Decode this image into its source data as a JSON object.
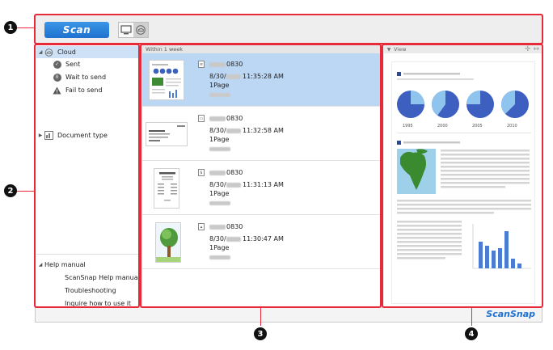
{
  "toolbar": {
    "scan_label": "Scan"
  },
  "sidebar": {
    "cloud_label": "Cloud",
    "items": [
      {
        "label": "Sent",
        "icon": "cloud-check-icon"
      },
      {
        "label": "Wait to send",
        "icon": "pause-icon"
      },
      {
        "label": "Fail to send",
        "icon": "warning-icon"
      }
    ],
    "document_type_label": "Document type",
    "help": {
      "title": "Help manual",
      "links": [
        "ScanSnap Help manual",
        "Troubleshooting",
        "Inquire how to use it"
      ]
    }
  },
  "list": {
    "group_header": "Within 1 week",
    "items": [
      {
        "name_suffix": "0830",
        "date_prefix": "8/30/",
        "time": "11:35:28 AM",
        "pages": "1Page",
        "type_icon": "document-type-icon",
        "selected": true
      },
      {
        "name_suffix": "0830",
        "date_prefix": "8/30/",
        "time": "11:32:58 AM",
        "pages": "1Page",
        "type_icon": "business-card-type-icon",
        "selected": false
      },
      {
        "name_suffix": "0830",
        "date_prefix": "8/30/",
        "time": "11:31:13 AM",
        "pages": "1Page",
        "type_icon": "receipt-type-icon",
        "selected": false
      },
      {
        "name_suffix": "0830",
        "date_prefix": "8/30/",
        "time": "11:30:47 AM",
        "pages": "1Page",
        "type_icon": "photo-type-icon",
        "selected": false
      }
    ]
  },
  "viewer": {
    "header_label": "View",
    "chart_years": [
      "1995",
      "2000",
      "2005",
      "2010"
    ]
  },
  "brand": "ScanSnap",
  "callouts": [
    "1",
    "2",
    "3",
    "4"
  ],
  "colors": {
    "accent": "#1f72cf",
    "outline": "#e8293a",
    "selection": "#bcd7f3"
  }
}
